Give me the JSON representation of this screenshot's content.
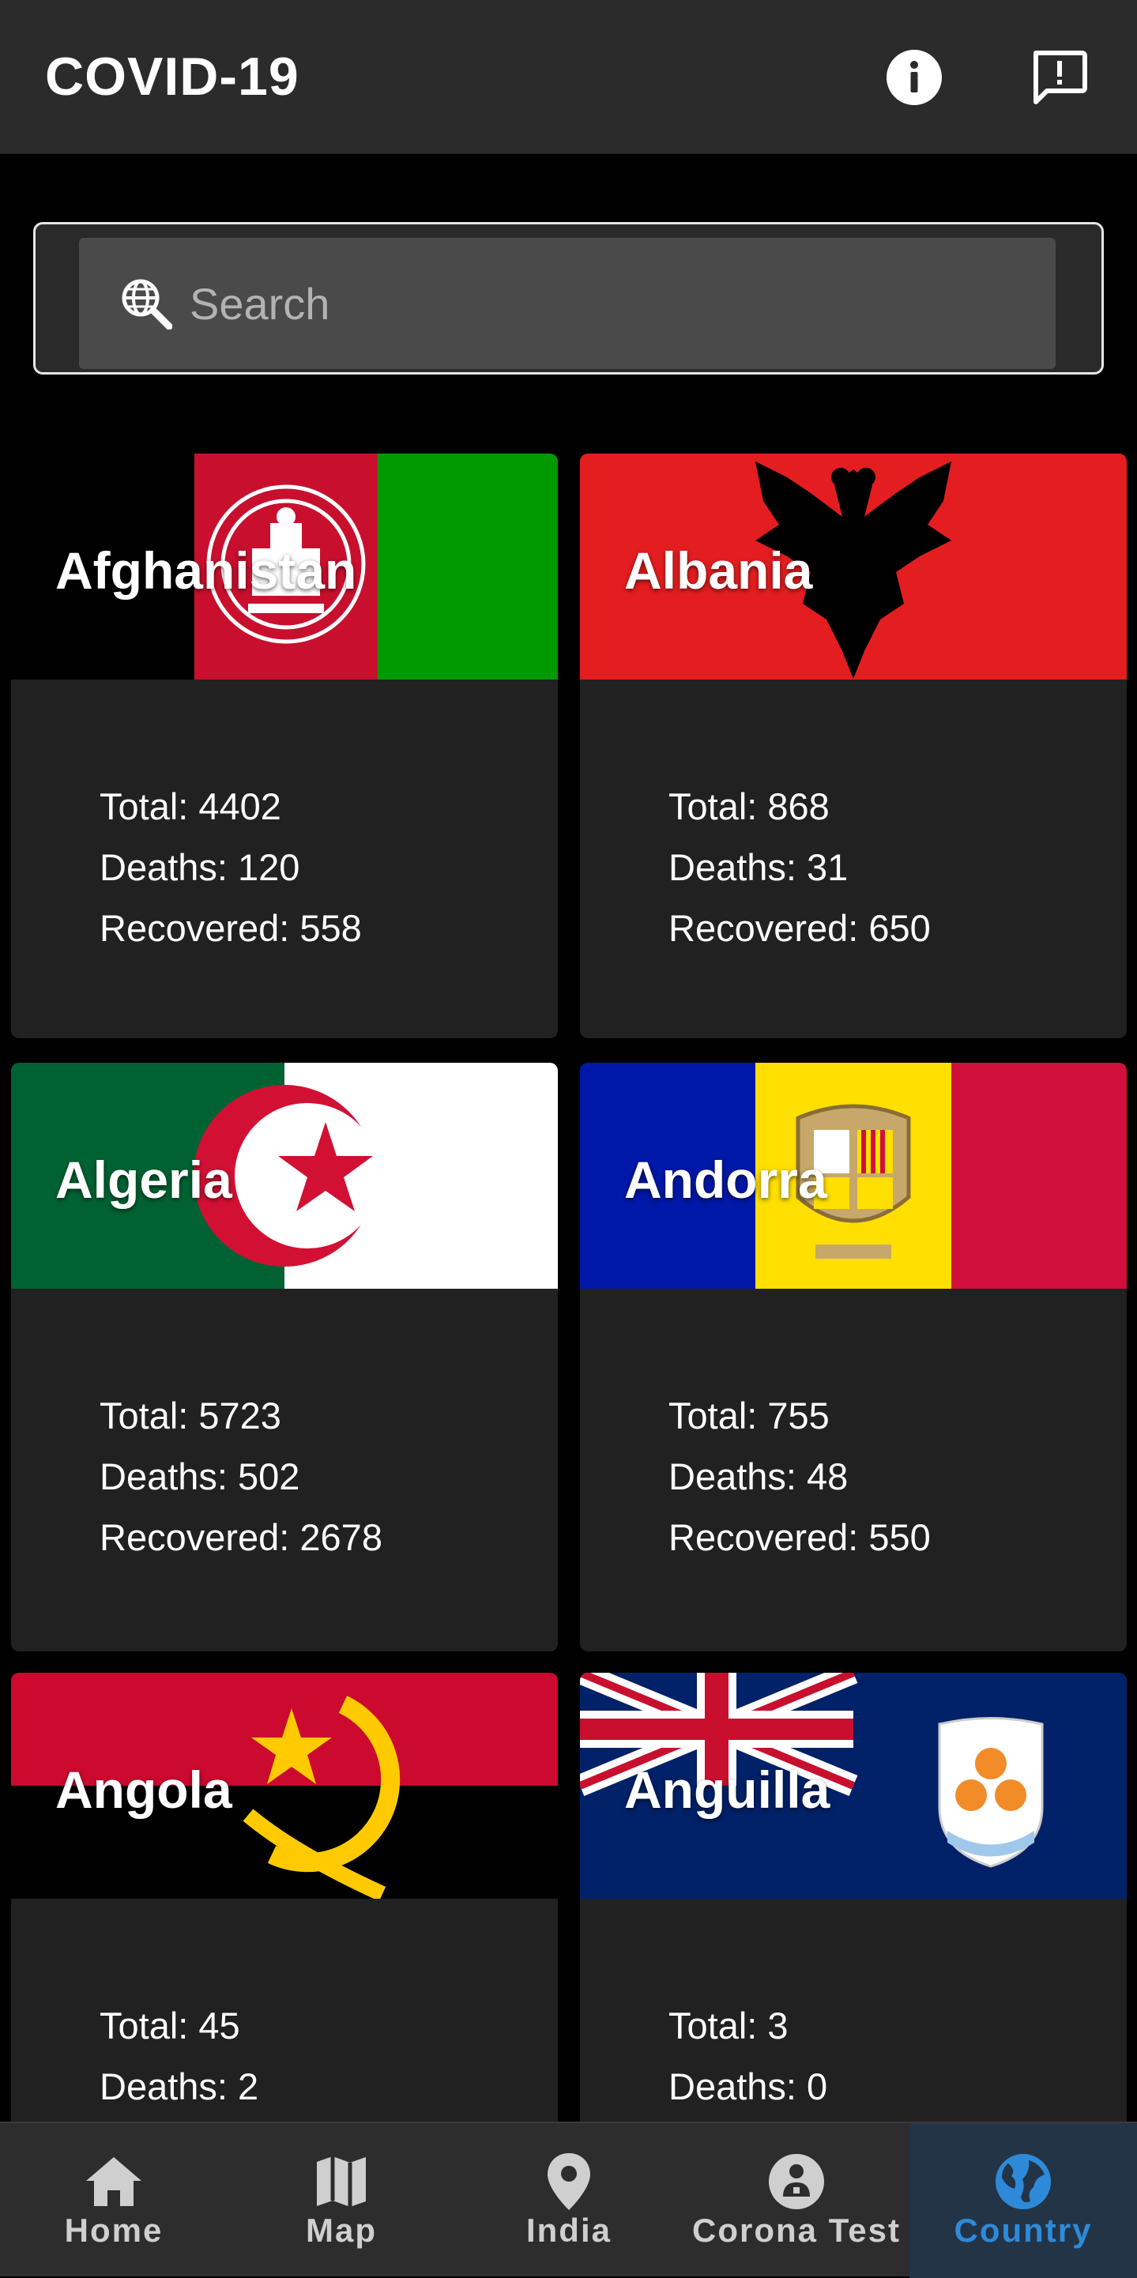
{
  "app_bar": {
    "title": "COVID-19",
    "info_icon": "info-icon",
    "feedback_icon": "feedback-icon"
  },
  "search": {
    "placeholder": "Search",
    "icon": "globe-search-icon"
  },
  "countries": [
    {
      "name": "Afghanistan",
      "total": "Total: 4402",
      "deaths": "Deaths: 120",
      "recovered": "Recovered: 558"
    },
    {
      "name": "Albania",
      "total": "Total: 868",
      "deaths": "Deaths: 31",
      "recovered": "Recovered: 650"
    },
    {
      "name": "Algeria",
      "total": "Total: 5723",
      "deaths": "Deaths: 502",
      "recovered": "Recovered: 2678"
    },
    {
      "name": "Andorra",
      "total": "Total: 755",
      "deaths": "Deaths: 48",
      "recovered": "Recovered: 550"
    },
    {
      "name": "Angola",
      "total": "Total: 45",
      "deaths": "Deaths: 2"
    },
    {
      "name": "Anguilla",
      "total": "Total: 3",
      "deaths": "Deaths: 0"
    }
  ],
  "bottom_nav": {
    "items": [
      {
        "label": "Home",
        "icon": "home-icon"
      },
      {
        "label": "Map",
        "icon": "map-icon"
      },
      {
        "label": "India",
        "icon": "location-pin-icon"
      },
      {
        "label": "Corona Test",
        "icon": "person-badge-icon"
      },
      {
        "label": "Country",
        "icon": "globe-icon",
        "active": true
      }
    ]
  },
  "colors": {
    "app_bar_bg": "#2b2b2b",
    "card_bg": "#212121",
    "nav_active_bg": "#233447",
    "nav_active_text": "#2e8ad8"
  }
}
